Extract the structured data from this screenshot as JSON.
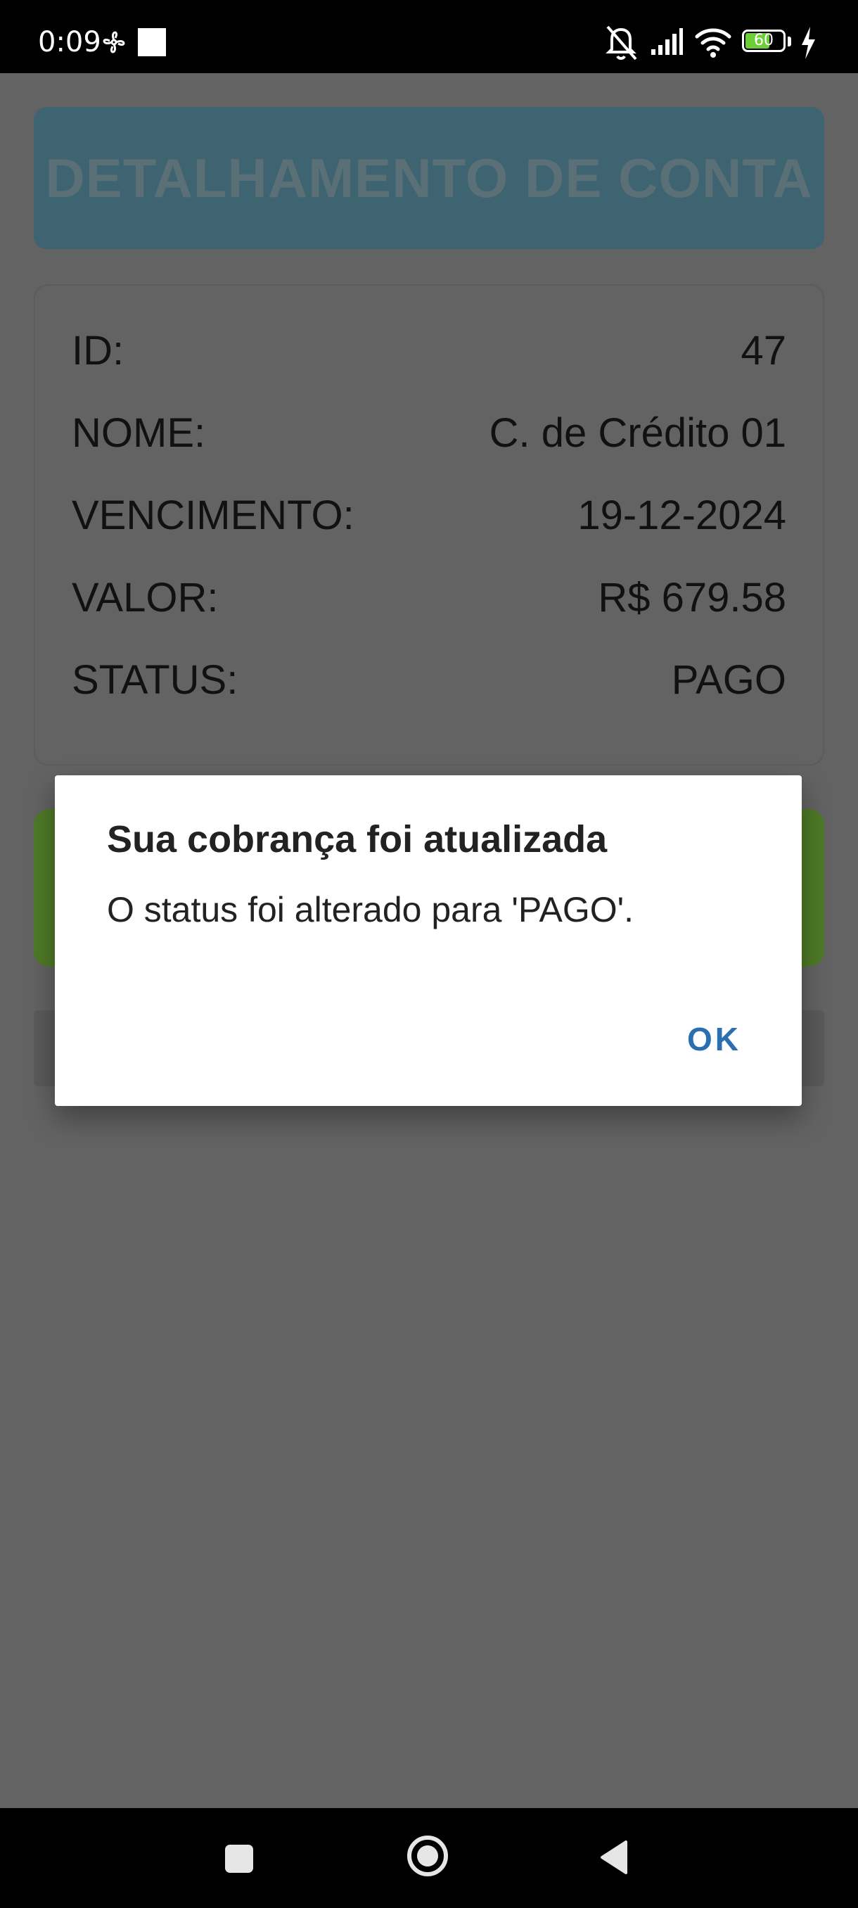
{
  "status_bar": {
    "time": "0:09",
    "battery_level": "60",
    "icons": [
      "fan-icon",
      "notification-square-icon",
      "silent-bell-icon",
      "signal-icon",
      "wifi-icon",
      "battery-icon",
      "charging-icon"
    ]
  },
  "header": {
    "title": "DETALHAMENTO DE CONTA"
  },
  "details": {
    "rows": [
      {
        "label": "ID:",
        "value": "47"
      },
      {
        "label": "NOME:",
        "value": "C. de Crédito 01"
      },
      {
        "label": "VENCIMENTO:",
        "value": "19-12-2024"
      },
      {
        "label": "VALOR:",
        "value": "R$ 679.58"
      },
      {
        "label": "STATUS:",
        "value": "PAGO"
      }
    ]
  },
  "dialog": {
    "title": "Sua cobrança foi atualizada",
    "message": "O status foi alterado para 'PAGO'.",
    "ok_label": "OK"
  },
  "colors": {
    "scrim_background": "#636363",
    "header_banner": "#3e6472",
    "header_text": "#5b6f76",
    "green_button": "#4e7a27",
    "dialog_accent": "#2a6fb0"
  },
  "nav_bar": {
    "icons": [
      "recents-square-icon",
      "home-circle-icon",
      "back-triangle-icon"
    ]
  }
}
